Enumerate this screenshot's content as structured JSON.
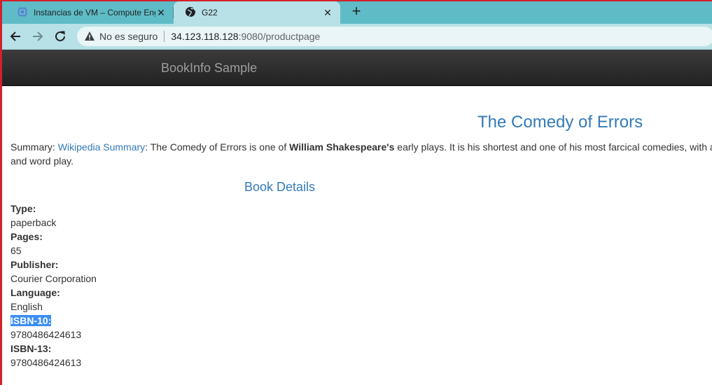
{
  "browser": {
    "tabs": [
      {
        "title": "Instancias de VM – Compute Engine",
        "active": false,
        "icon": "compute-engine-icon"
      },
      {
        "title": "G22",
        "active": true,
        "icon": "globe-icon"
      }
    ],
    "new_tab_label": "+",
    "security_label": "No es seguro",
    "url_host": "34.123.118.128",
    "url_rest": ":9080/productpage"
  },
  "page": {
    "brand": "BookInfo Sample",
    "title": "The Comedy of Errors",
    "summary": {
      "prefix": "Summary: ",
      "link_text": "Wikipedia Summary",
      "text_before_bold": ": The Comedy of Errors is one of ",
      "bold": "William Shakespeare's",
      "text_after_bold": " early plays. It is his shortest and one of his most farcical comedies, with a",
      "line2": "and word play."
    },
    "details_heading": "Book Details",
    "details": [
      {
        "label": "Type:",
        "value": "paperback"
      },
      {
        "label": "Pages:",
        "value": "65"
      },
      {
        "label": "Publisher:",
        "value": "Courier Corporation"
      },
      {
        "label": "Language:",
        "value": "English"
      },
      {
        "label": "ISBN-10:",
        "value": "9780486424613"
      },
      {
        "label": "ISBN-13:",
        "value": "9780486424613"
      }
    ]
  },
  "colors": {
    "tabstrip": "#5fbcc6",
    "toolbar": "#b7e1e6",
    "link": "#337ab7",
    "selection": "#3c8ef5"
  }
}
